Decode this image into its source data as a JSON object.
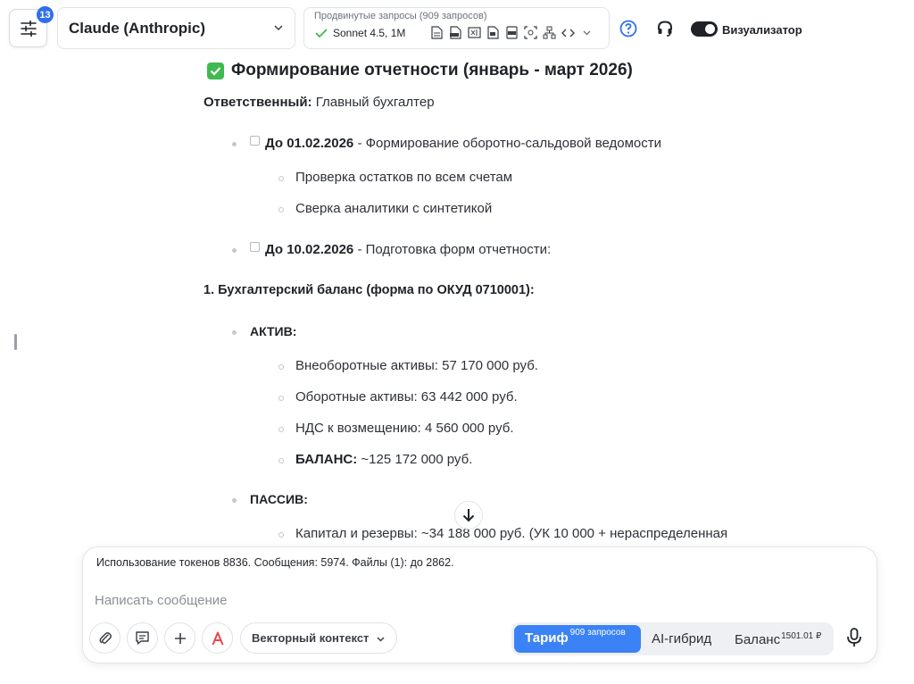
{
  "header": {
    "settings_badge": "13",
    "model_name": "Claude (Anthropic)",
    "advanced_title": "Продвинутые запросы (909 запросов)",
    "advanced_model": "Sonnet 4.5, 1M",
    "visualizer_label": "Визуализатор",
    "visualizer_on": true
  },
  "document": {
    "heading": "Формирование отчетности (январь - март 2026)",
    "responsible_label": "Ответственный:",
    "responsible_value": " Главный бухгалтер",
    "task1_date": "До 01.02.2026",
    "task1_text": " - Формирование оборотно-сальдовой ведомости",
    "task1_sub1": "Проверка остатков по всем счетам",
    "task1_sub2": "Сверка аналитики с синтетикой",
    "task2_date": "До 10.02.2026",
    "task2_text": " - Подготовка форм отчетности:",
    "section1": "1. Бухгалтерский баланс (форма по ОКУД 0710001):",
    "assets_label": "АКТИВ:",
    "assets_items": [
      "Внеоборотные активы: 57 170 000 руб.",
      "Оборотные активы: 63 442 000 руб.",
      "НДС к возмещению: 4 560 000 руб."
    ],
    "balance_label": "БАЛАНС:",
    "balance_value": " ~125 172 000 руб.",
    "liabilities_label": "ПАССИВ:",
    "liabilities_item1": "Капитал и резервы: ~34 188 000 руб. (УК 10 000 + нераспределенная"
  },
  "composer": {
    "usage_text": "Использование токенов 8836. Сообщения: 5974. Файлы (1): до 2862.",
    "placeholder": "Написать сообщение",
    "vector_context_label": "Векторный контекст",
    "plan_label": "Тариф",
    "plan_sup": "909 запросов",
    "hybrid_label": "AI-гибрид",
    "balance_label": "Баланс",
    "balance_sup": "1501.01 ₽"
  },
  "colors": {
    "accent": "#3b82f6",
    "badge": "#2f6ff0",
    "success": "#3fb950"
  }
}
